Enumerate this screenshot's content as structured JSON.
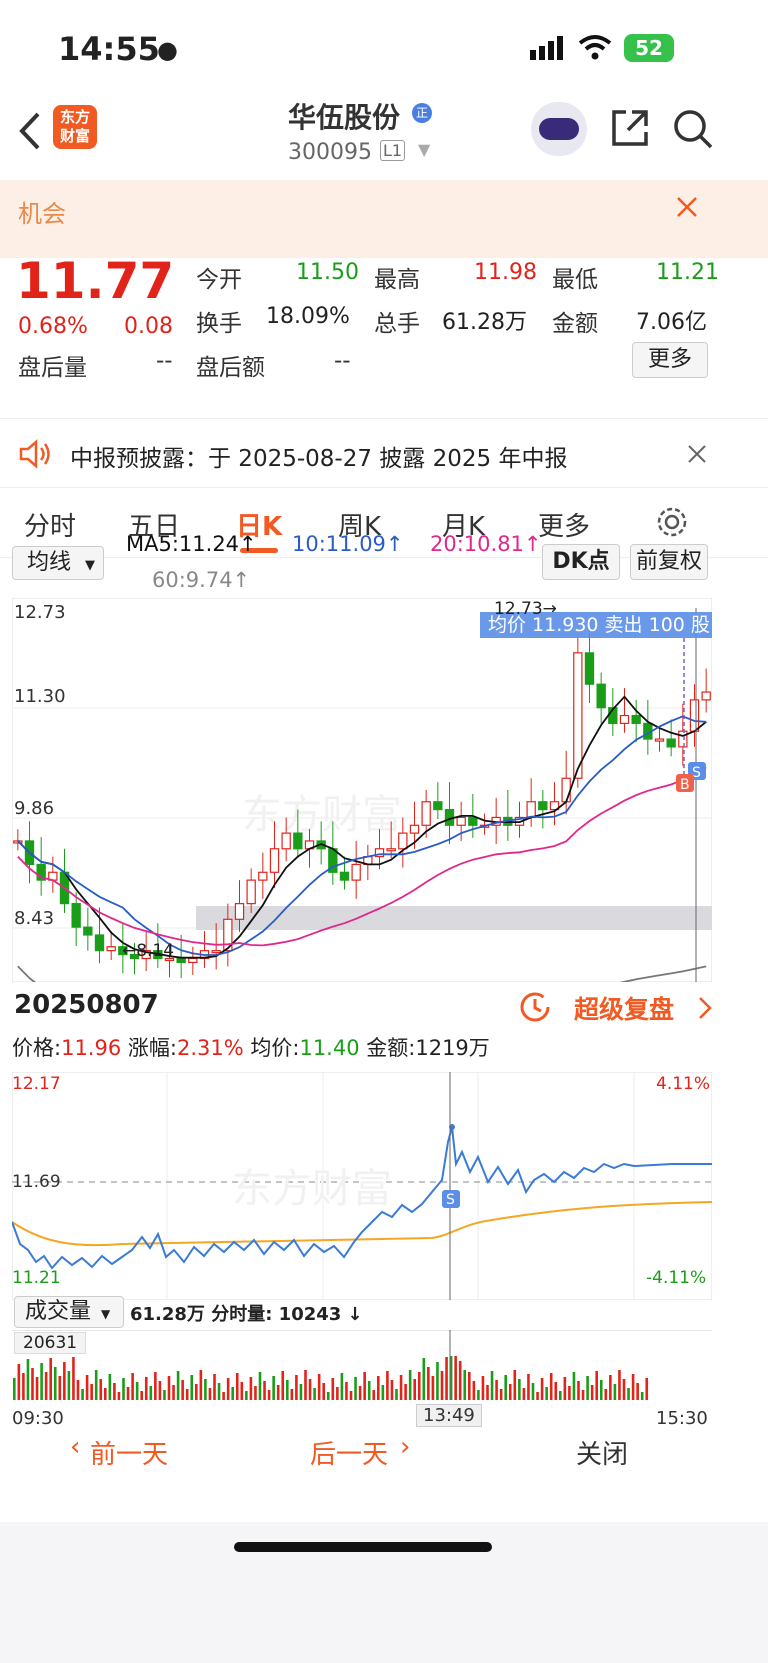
{
  "status": {
    "time": "14:55",
    "battery": "52"
  },
  "header": {
    "title": "华伍股份",
    "badge": "正",
    "code": "300095",
    "level": "L1",
    "logo_line1": "东方",
    "logo_line2": "财富"
  },
  "banner": {
    "text": "机会"
  },
  "quote": {
    "price": "11.77",
    "pct": "0.68%",
    "chg": "0.08",
    "after_vol_label": "盘后量",
    "after_vol": "--",
    "after_amt_label": "盘后额",
    "after_amt": "--",
    "open_label": "今开",
    "open": "11.50",
    "high_label": "最高",
    "high": "11.98",
    "low_label": "最低",
    "low": "11.21",
    "turnover_label": "换手",
    "turnover": "18.09%",
    "vol_label": "总手",
    "vol": "61.28万",
    "amount_label": "金额",
    "amount": "7.06亿",
    "more": "更多"
  },
  "notice": {
    "text": "中报预披露：于 2025-08-27 披露 2025 年中报"
  },
  "tabs": [
    "分时",
    "五日",
    "日K",
    "周K",
    "月K",
    "更多"
  ],
  "kline": {
    "ma_select": "均线",
    "ma5": "MA5:11.24↑",
    "ma10": "10:11.09↑",
    "ma20": "20:10.81↑",
    "ma60": "60:9.74↑",
    "dk_btn": "DK点",
    "fq_btn": "前复权",
    "y_labels": [
      "12.73",
      "11.30",
      "9.86",
      "8.43"
    ],
    "max_label": "12.73→",
    "min_label": "←8.14",
    "tooltip": "均价 11.930 卖出 100 股",
    "watermark": "东方财富",
    "colors": {
      "up": "#e2231a",
      "down": "#1a9e1a",
      "ma5": "#111111",
      "ma10": "#2a5cc8",
      "ma20": "#e0288c",
      "ma60": "#777777"
    }
  },
  "detail": {
    "date": "20250807",
    "replay": "超级复盘",
    "price_label": "价格:",
    "price": "11.96",
    "chg_label": "涨幅:",
    "chg": "2.31%",
    "avg_label": "均价:",
    "avg": "11.40",
    "amt_label": "金额:",
    "amt": "1219万",
    "y_top": "12.17",
    "y_mid": "11.69",
    "y_bot": "11.21",
    "pct_top": "4.11%",
    "pct_bot": "-4.11%",
    "vol_select": "成交量",
    "vol_info": "61.28万 分时量: 10243 ↓",
    "vol_max": "20631",
    "t_start": "09:30",
    "t_cursor": "13:49",
    "t_end": "15:30",
    "watermark": "东方财富"
  },
  "bottom": {
    "prev": "前一天",
    "next": "后一天",
    "close": "关闭"
  }
}
